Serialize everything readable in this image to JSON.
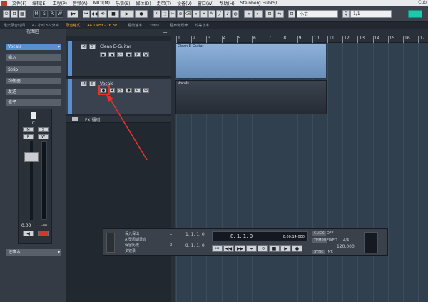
{
  "menu": {
    "items": [
      "文件(F)",
      "编辑(E)",
      "工程(P)",
      "音频(A)",
      "MIDI(M)",
      "乐谱(S)",
      "媒体(D)",
      "走带(T)",
      "设备(V)",
      "窗口(W)",
      "帮助(H)",
      "Steinberg Hub(S)"
    ],
    "app_title": "Cub"
  },
  "toolbar": {
    "m_label": "M",
    "s_label": "S",
    "r_label": "R",
    "w_label": "W",
    "grid_type": "小节",
    "quantize": "1/1"
  },
  "status": {
    "record_time": "最大录音时间",
    "record_value": "42 小时 55 分钟",
    "record_format": "录音格式",
    "format_value": "44.1 kHz - 16 Bit",
    "frame_rate": "工程帧速率",
    "fps_value": "30fps",
    "pan_law": "工程声像规律",
    "pan_value": "均等功率"
  },
  "inspector": {
    "title": "视图区",
    "track_name": "Vocals",
    "rows": [
      "插入",
      "Strip",
      "均衡器",
      "发送",
      "推子"
    ],
    "pan_value": "C",
    "m_label": "M",
    "s_label": "S",
    "r_label": "R",
    "w_label": "W",
    "volume_value": "0.00",
    "volume_unit": "-oo",
    "notepad": "记事本"
  },
  "tracks": {
    "add_label": "+",
    "items": [
      {
        "name": "Clean E-Guitar"
      },
      {
        "name": "Vocals"
      }
    ],
    "fx_label": "FX 通道",
    "m_label": "M",
    "s_label": "S",
    "r_label": "R",
    "w_label": "W"
  },
  "ruler": {
    "bars": [
      "1",
      "2",
      "3",
      "4",
      "5",
      "6",
      "7",
      "8",
      "9",
      "10",
      "11",
      "12",
      "13",
      "14",
      "15",
      "16",
      "17"
    ]
  },
  "events": [
    {
      "name": "Clean E-Guitar"
    },
    {
      "name": "Vocals"
    }
  ],
  "transport": {
    "mode1": "保入保出",
    "mode2": "A 型周期录音",
    "mode3": "保留历史",
    "mode4": "多镜录",
    "l_label": "L",
    "r_label": "R",
    "locator_left": "1. 1. 1. 0",
    "locator_right": "9. 1. 1. 0",
    "position": "8. 1. 1. 0",
    "position_time": "0:00:14.000",
    "click_label": "CLICK",
    "click_value": "OFF",
    "tempo_track_label": "TEMPO",
    "tempo_mode": "FIXED",
    "signature": "4/4",
    "tempo_value": "120.000",
    "sync_label": "SYNC",
    "sync_value": "INT."
  },
  "colors": {
    "accent": "#5a8fcf",
    "annotation": "#e8302e",
    "event_fill": "#7d9fc7"
  }
}
